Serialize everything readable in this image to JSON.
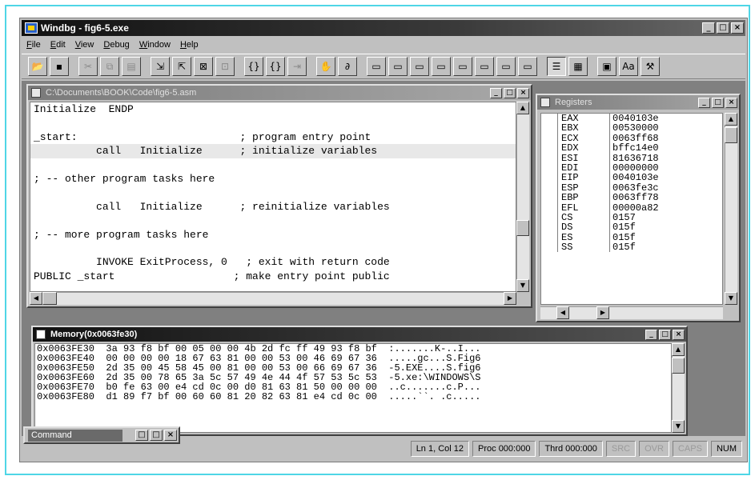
{
  "app": {
    "title": "Windbg - fig6-5.exe"
  },
  "menu": [
    "File",
    "Edit",
    "View",
    "Debug",
    "Window",
    "Help"
  ],
  "toolbar": {
    "icons": [
      "open-icon",
      "save-icon",
      "cut-icon",
      "copy-icon",
      "paste-icon",
      "go-icon",
      "restart-icon",
      "stop-icon",
      "break-icon",
      "step-into-icon",
      "step-over-icon",
      "run-to-cursor-icon",
      "breakpoint-icon",
      "quickwatch-icon",
      "watch-window-icon",
      "locals-window-icon",
      "registers-window-icon",
      "memory-window-icon",
      "callstack-window-icon",
      "disassembly-window-icon",
      "command-window-icon",
      "source-mode-icon",
      "hex-mode-icon",
      "options-icon",
      "font-icon",
      "tools-icon"
    ]
  },
  "source": {
    "title": "C:\\Documents\\BOOK\\Code\\fig6-5.asm",
    "lines": [
      "Initialize  ENDP",
      "",
      "_start:                          ; program entry point",
      "          call   Initialize      ; initialize variables",
      "",
      "; -- other program tasks here",
      "",
      "          call   Initialize      ; reinitialize variables",
      "",
      "; -- more program tasks here",
      "",
      "          INVOKE ExitProcess, 0   ; exit with return code",
      "PUBLIC _start                   ; make entry point public"
    ],
    "highlight_line": 3
  },
  "registers": {
    "title": "Registers",
    "rows": [
      {
        "name": "EAX",
        "value": "0040103e"
      },
      {
        "name": "EBX",
        "value": "00530000"
      },
      {
        "name": "ECX",
        "value": "0063ff68"
      },
      {
        "name": "EDX",
        "value": "bffc14e0"
      },
      {
        "name": "ESI",
        "value": "81636718"
      },
      {
        "name": "EDI",
        "value": "00000000"
      },
      {
        "name": "EIP",
        "value": "0040103e"
      },
      {
        "name": "ESP",
        "value": "0063fe3c"
      },
      {
        "name": "EBP",
        "value": "0063ff78"
      },
      {
        "name": "EFL",
        "value": "00000a82"
      },
      {
        "name": "CS",
        "value": "0157"
      },
      {
        "name": "DS",
        "value": "015f"
      },
      {
        "name": "ES",
        "value": "015f"
      },
      {
        "name": "SS",
        "value": "015f"
      }
    ]
  },
  "memory": {
    "title": "Memory(0x0063fe30)",
    "lines": [
      "0x0063FE30  3a 93 f8 bf 00 05 00 00 4b 2d fc ff 49 93 f8 bf  :.......K-..I...",
      "0x0063FE40  00 00 00 00 18 67 63 81 00 00 53 00 46 69 67 36  .....gc...S.Fig6",
      "0x0063FE50  2d 35 00 45 58 45 00 81 00 00 53 00 66 69 67 36  -5.EXE....S.fig6",
      "0x0063FE60  2d 35 00 78 65 3a 5c 57 49 4e 44 4f 57 53 5c 53  -5.xe:\\WINDOWS\\S",
      "0x0063FE70  b0 fe 63 00 e4 cd 0c 00 d0 81 63 81 50 00 00 00  ..c.......c.P...",
      "0x0063FE80  d1 89 f7 bf 00 60 60 81 20 82 63 81 e4 cd 0c 00  .....``. .c....."
    ]
  },
  "minimized": {
    "title": "Command"
  },
  "status": {
    "position": "Ln 1, Col 12",
    "process": "Proc 000:000",
    "thread": "Thrd 000:000",
    "indicators": [
      "SRC",
      "OVR",
      "CAPS",
      "NUM"
    ]
  }
}
